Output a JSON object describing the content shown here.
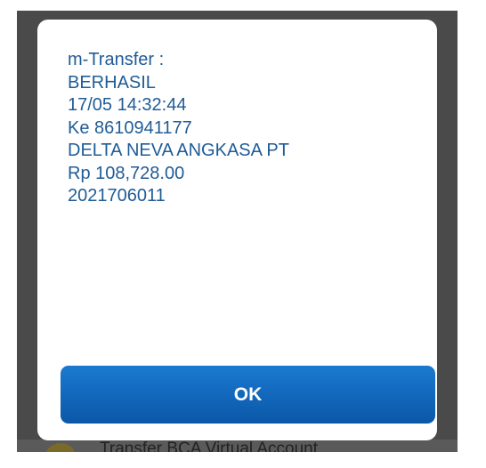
{
  "dialog": {
    "lines": [
      "m-Transfer :",
      "BERHASIL",
      "17/05 14:32:44",
      "Ke 8610941177",
      "DELTA NEVA ANGKASA PT",
      "Rp 108,728.00",
      "2021706011"
    ],
    "ok_label": "OK"
  },
  "background": {
    "menu_item": "Transfer BCA Virtual Account"
  },
  "colors": {
    "text": "#1f5c96",
    "button": "#0b62b8"
  }
}
